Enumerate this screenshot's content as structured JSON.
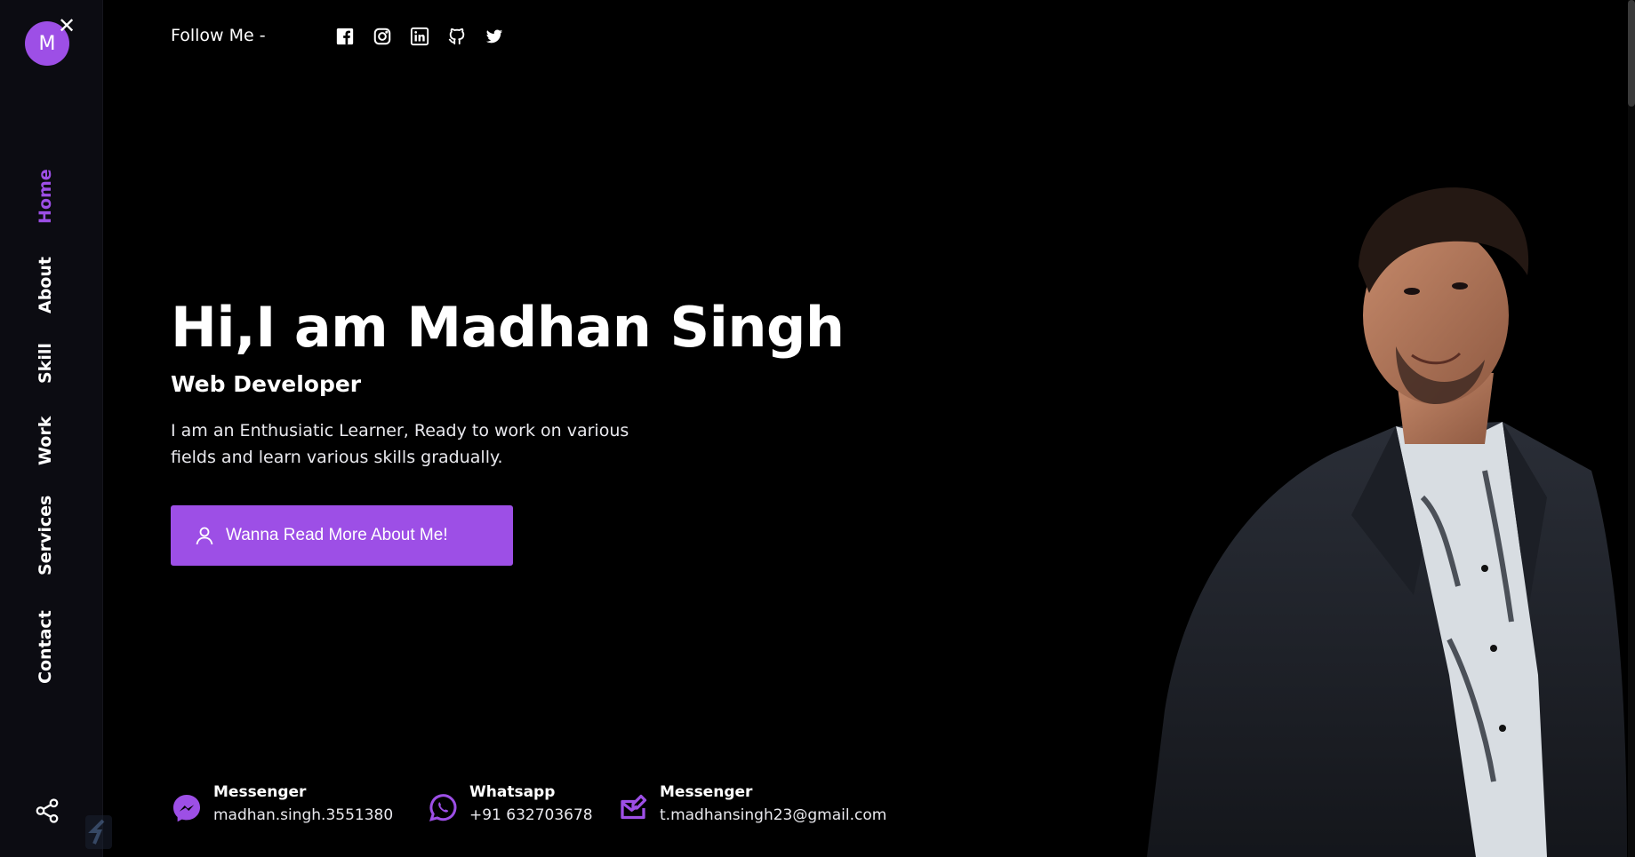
{
  "sidebar": {
    "avatar_letter": "M",
    "close_icon": "close-icon",
    "nav": [
      {
        "label": "Home",
        "active": true
      },
      {
        "label": "About"
      },
      {
        "label": "Skill"
      },
      {
        "label": "Work"
      },
      {
        "label": "Services"
      },
      {
        "label": "Contact"
      }
    ],
    "share_icon": "share-icon"
  },
  "header": {
    "follow_label": "Follow Me -",
    "social": [
      "facebook-icon",
      "instagram-icon",
      "linkedin-icon",
      "github-icon",
      "twitter-icon"
    ]
  },
  "hero": {
    "title": "Hi,I am Madhan Singh",
    "subtitle": "Web Developer",
    "description": "I am an Enthusiatic Learner, Ready to work on various fields and learn various skills gradually.",
    "cta_label": "Wanna Read More About Me!"
  },
  "contacts": [
    {
      "title": "Messenger",
      "value": "madhan.singh.3551380",
      "icon": "messenger-icon"
    },
    {
      "title": "Whatsapp",
      "value": "+91 632703678",
      "icon": "whatsapp-icon"
    },
    {
      "title": "Messenger",
      "value": "t.madhansingh23@gmail.com",
      "icon": "mail-icon"
    }
  ],
  "colors": {
    "accent": "#9d4fe6",
    "background": "#000000",
    "sidebar": "#0c0c12"
  }
}
